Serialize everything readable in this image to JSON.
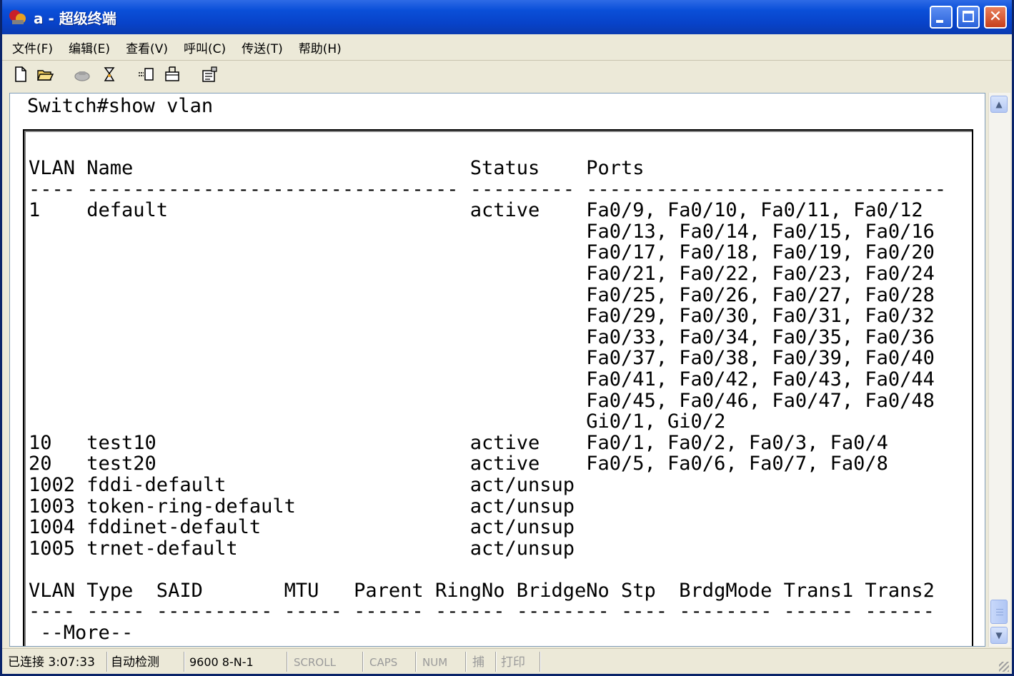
{
  "window": {
    "title": "a - 超级终端",
    "accent_color": "#0A4FD8",
    "close_color": "#C6401C"
  },
  "menu": {
    "items": [
      "文件(F)",
      "编辑(E)",
      "查看(V)",
      "呼叫(C)",
      "传送(T)",
      "帮助(H)"
    ]
  },
  "toolbar": {
    "icons": [
      "new-file-icon",
      "open-folder-icon",
      "call-icon",
      "disconnect-icon",
      "send-icon",
      "receive-icon",
      "properties-icon"
    ]
  },
  "terminal": {
    "header": "Switch#show vlan",
    "lines": [
      "VLAN Name                             Status    Ports",
      "---- -------------------------------- --------- -------------------------------",
      "1    default                          active    Fa0/9, Fa0/10, Fa0/11, Fa0/12",
      "                                                Fa0/13, Fa0/14, Fa0/15, Fa0/16",
      "                                                Fa0/17, Fa0/18, Fa0/19, Fa0/20",
      "                                                Fa0/21, Fa0/22, Fa0/23, Fa0/24",
      "                                                Fa0/25, Fa0/26, Fa0/27, Fa0/28",
      "                                                Fa0/29, Fa0/30, Fa0/31, Fa0/32",
      "                                                Fa0/33, Fa0/34, Fa0/35, Fa0/36",
      "                                                Fa0/37, Fa0/38, Fa0/39, Fa0/40",
      "                                                Fa0/41, Fa0/42, Fa0/43, Fa0/44",
      "                                                Fa0/45, Fa0/46, Fa0/47, Fa0/48",
      "                                                Gi0/1, Gi0/2",
      "10   test10                           active    Fa0/1, Fa0/2, Fa0/3, Fa0/4",
      "20   test20                           active    Fa0/5, Fa0/6, Fa0/7, Fa0/8",
      "1002 fddi-default                     act/unsup",
      "1003 token-ring-default               act/unsup",
      "1004 fddinet-default                  act/unsup",
      "1005 trnet-default                    act/unsup",
      "",
      "VLAN Type  SAID       MTU   Parent RingNo BridgeNo Stp  BrdgMode Trans1 Trans2",
      "---- ----- ---------- ----- ------ ------ -------- ---- -------- ------ ------",
      " --More--"
    ]
  },
  "statusbar": {
    "connected": "已连接 3:07:33",
    "detect": "自动检测",
    "baud": "9600 8-N-1",
    "scroll": "SCROLL",
    "caps": "CAPS",
    "num": "NUM",
    "capture": "捕",
    "print": "打印"
  }
}
